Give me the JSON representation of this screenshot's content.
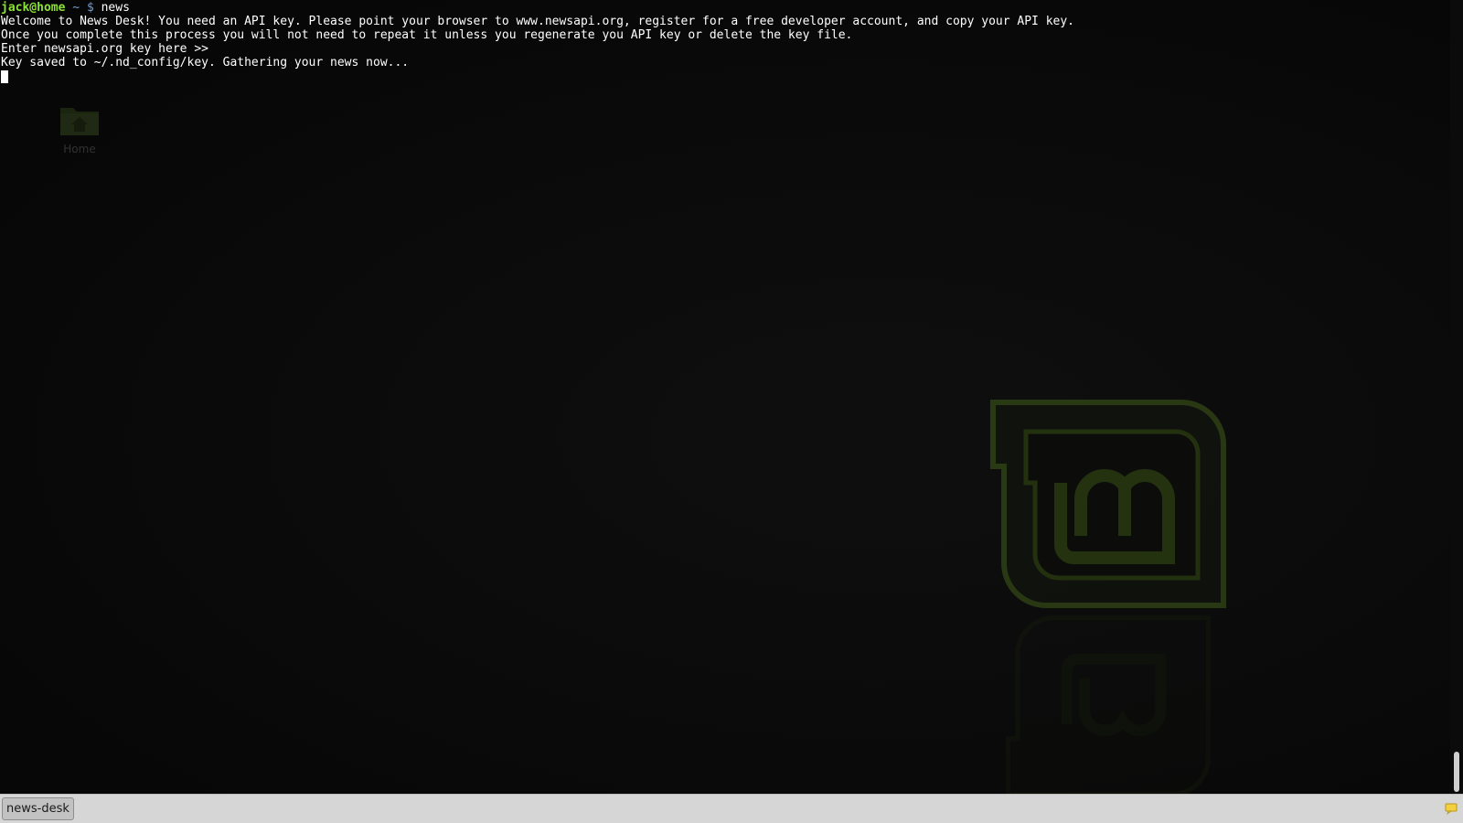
{
  "desktop": {
    "home_icon_label": "Home"
  },
  "terminal": {
    "prompt": {
      "user_host": "jack@home",
      "path": "~",
      "symbol": "$",
      "command": "news"
    },
    "output_lines": [
      "Welcome to News Desk! You need an API key. Please point your browser to www.newsapi.org, register for a free developer account, and copy your API key.",
      "Once you complete this process you will not need to repeat it unless you regenerate you API key or delete the key file.",
      "Enter newsapi.org key here >>",
      "Key saved to ~/.nd_config/key. Gathering your news now..."
    ]
  },
  "taskbar": {
    "window_button_label": "news-desk",
    "tray_icon": "notification-icon"
  },
  "colors": {
    "prompt_user": "#8ae234",
    "prompt_path": "#729fcf",
    "terminal_text": "#ffffff",
    "panel_bg": "#d6d6d6",
    "mint_green": "#6d9a2c"
  }
}
